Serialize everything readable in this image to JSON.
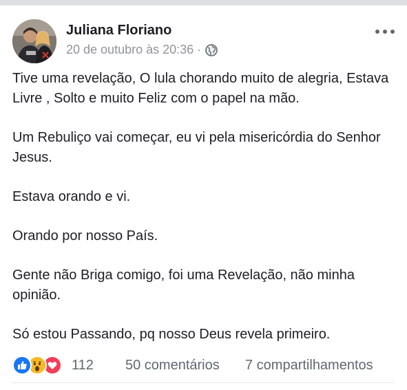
{
  "post": {
    "author": "Juliana Floriano",
    "timestamp": "20 de outubro às 20:36",
    "separator": "·",
    "privacy_icon": "globe-icon",
    "menu_icon": "more-options-icon",
    "paragraphs": [
      "Tive uma revelação, O lula chorando muito de alegria, Estava Livre , Solto e muito Feliz com o papel na mão.",
      "Um Rebuliço vai começar, eu vi pela misericórdia do Senhor Jesus.",
      "Estava orando e vi.",
      "Orando por nosso País.",
      "Gente não Briga comigo, foi uma Revelação, não minha opinião.",
      "Só estou Passando, pq nosso Deus revela primeiro."
    ]
  },
  "footer": {
    "reaction_icons": [
      "like-icon",
      "wow-icon",
      "love-icon"
    ],
    "reactions_count": "112",
    "comments": "50 comentários",
    "shares": "7 compartilhamentos"
  },
  "colors": {
    "like": "#1877f2",
    "wow": "#f7b928",
    "love": "#f33e58",
    "secondary_text": "#90949c"
  }
}
